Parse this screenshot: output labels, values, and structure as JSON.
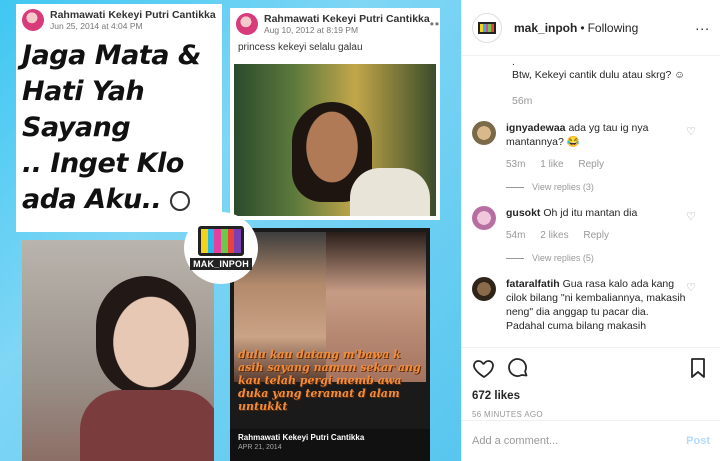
{
  "media": {
    "card1": {
      "name": "Rahmawati Kekeyi Putri Cantikka",
      "date": "Jun 25, 2014 at 4:04 PM",
      "quote_lines": [
        "Jaga Mata &",
        "Hati Yah Sayang",
        ".. Inget Klo",
        "ada Aku.."
      ]
    },
    "card2": {
      "name": "Rahmawati Kekeyi Putri Cantikka",
      "date": "Aug 10, 2012 at 8:19 PM",
      "caption": "princess kekeyi selalu galau"
    },
    "card4": {
      "lyrics": "dulu kau datang m'bawa k asih sayang namun sekar ang kau telah pergi memb awa duka yang teramat d alam untukkt",
      "sig_name": "Rahmawati Kekeyi Putri Cantikka",
      "sig_date": "APR 21, 2014"
    },
    "watermark": "MAK_INPOH",
    "tv_colors": [
      "#f5d31c",
      "#2ab7e6",
      "#e43fa1",
      "#6dc94a",
      "#e8433b",
      "#7b3fb5"
    ]
  },
  "header": {
    "username": "mak_inpoh",
    "separator": "•",
    "follow_status": "Following",
    "more": "..."
  },
  "top_comment": {
    "dot": ".",
    "text": "Btw, Kekeyi cantik dulu atau skrg? ☺",
    "time": "56m"
  },
  "comments": [
    {
      "user": "ignyadewaa",
      "text": "ada yg tau ig nya mantannya? 😂",
      "time": "53m",
      "likes": "1 like",
      "reply": "Reply",
      "view_replies": "View replies (3)",
      "avatar_color": "#b0956e"
    },
    {
      "user": "gusokt",
      "text": "Oh jd itu mantan dia",
      "time": "54m",
      "likes": "2 likes",
      "reply": "Reply",
      "view_replies": "View replies (5)",
      "avatar_color": "#c98fb4"
    },
    {
      "user": "fataralfatih",
      "text": "Gua rasa kalo ada kang cilok bilang \"ni kembaliannya, makasih neng\" dia anggap tu pacar dia. Padahal cuma bilang makasih",
      "avatar_color": "#4a3a2a"
    }
  ],
  "footer": {
    "likes": "672 likes",
    "ago": "56 MINUTES AGO",
    "placeholder": "Add a comment...",
    "post": "Post"
  },
  "icons": [
    "heart-icon",
    "comment-icon",
    "bookmark-icon",
    "more-icon",
    "smiley-icon"
  ]
}
